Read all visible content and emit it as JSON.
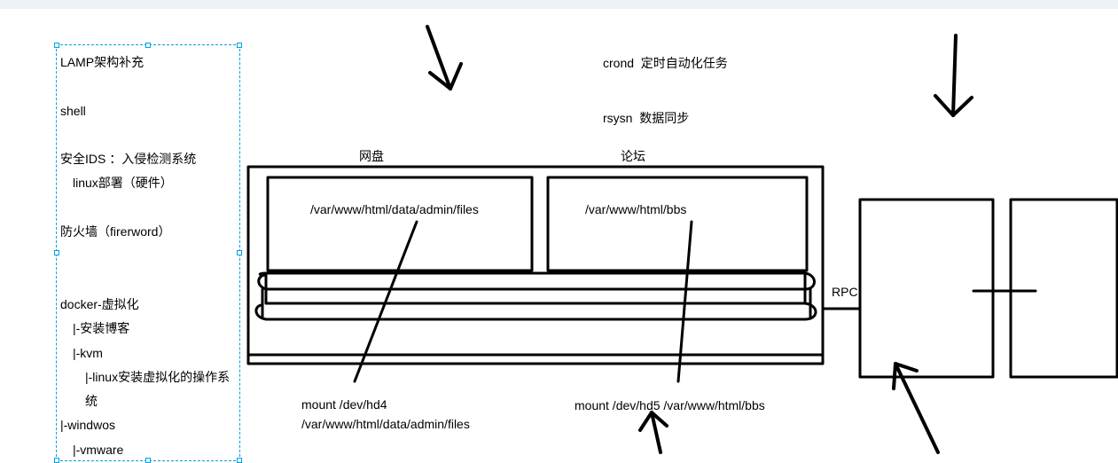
{
  "notes_block": {
    "lines": [
      {
        "text": "LAMP架构补充",
        "indent": 0
      },
      {
        "text": "",
        "indent": 0
      },
      {
        "text": "shell",
        "indent": 0
      },
      {
        "text": "",
        "indent": 0
      },
      {
        "text": "安全IDS  ：入侵检测系统",
        "indent": 0
      },
      {
        "text": "linux部署（硬件）",
        "indent": 1
      },
      {
        "text": "",
        "indent": 0
      },
      {
        "text": "防火墙（firerword）",
        "indent": 0
      },
      {
        "text": "",
        "indent": 0
      },
      {
        "text": "",
        "indent": 0
      },
      {
        "text": "docker-虚拟化",
        "indent": 0
      },
      {
        "text": "|-安装博客",
        "indent": 1
      },
      {
        "text": "|-kvm",
        "indent": 1
      },
      {
        "text": "|-linux安装虚拟化的操作系统",
        "indent": 2
      },
      {
        "text": "|-windwos",
        "indent": 0
      },
      {
        "text": "|-vmware",
        "indent": 1
      }
    ]
  },
  "labels": {
    "crond": "crond  定时自动化任务",
    "rsysn": "rsysn  数据同步",
    "wangpan": "网盘",
    "luntan": "论坛",
    "path_files": "/var/www/html/data/admin/files",
    "path_bbs": "/var/www/html/bbs",
    "mount_hd4": "mount /dev/hd4 /var/www/html/data/admin/files",
    "mount_hd5": "mount /dev/hd5 /var/www/html/bbs",
    "rpc": "RPC"
  },
  "colors": {
    "select_border": "#009fe3",
    "ink": "#000000"
  }
}
